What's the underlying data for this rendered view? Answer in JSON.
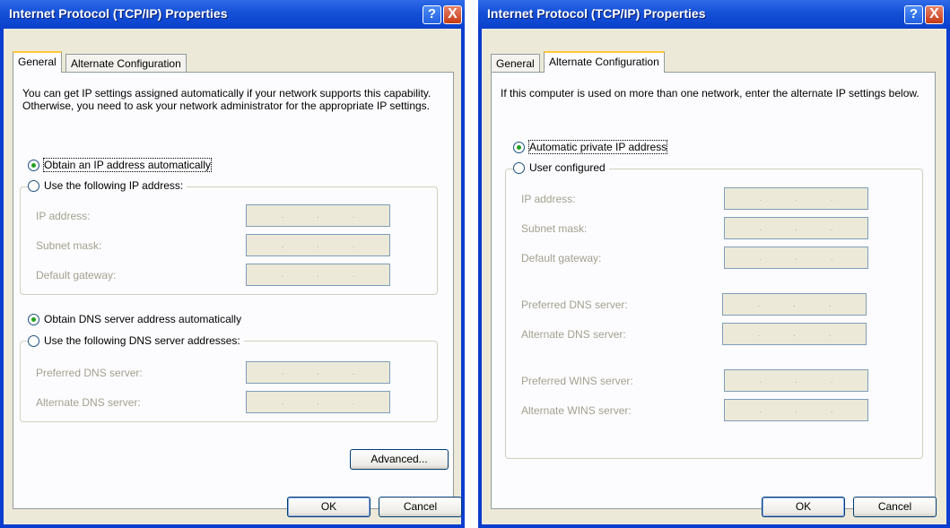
{
  "left": {
    "title": "Internet Protocol (TCP/IP) Properties",
    "help_label": "?",
    "close_label": "X",
    "tabs": [
      {
        "label": "General",
        "active": true
      },
      {
        "label": "Alternate Configuration",
        "active": false
      }
    ],
    "intro": "You can get IP settings assigned automatically if your network supports this capability. Otherwise, you need to ask your network administrator for the appropriate IP settings.",
    "ip_auto_label": "Obtain an IP address automatically",
    "ip_manual_label": "Use the following IP address:",
    "fields_ip": [
      {
        "label": "IP address:",
        "value": ". . ."
      },
      {
        "label": "Subnet mask:",
        "value": ". . ."
      },
      {
        "label": "Default gateway:",
        "value": ". . ."
      }
    ],
    "dns_auto_label": "Obtain DNS server address automatically",
    "dns_manual_label": "Use the following DNS server addresses:",
    "fields_dns": [
      {
        "label": "Preferred DNS server:",
        "value": ". . ."
      },
      {
        "label": "Alternate DNS server:",
        "value": ". . ."
      }
    ],
    "advanced_label": "Advanced...",
    "ok_label": "OK",
    "cancel_label": "Cancel"
  },
  "right": {
    "title": "Internet Protocol (TCP/IP) Properties",
    "help_label": "?",
    "close_label": "X",
    "tabs": [
      {
        "label": "General",
        "active": false
      },
      {
        "label": "Alternate Configuration",
        "active": true
      }
    ],
    "intro": "If this computer is used on more than one network, enter the alternate IP settings below.",
    "auto_private_label": "Automatic private IP address",
    "user_configured_label": "User configured",
    "fields": [
      {
        "label": "IP address:",
        "value": ". . ."
      },
      {
        "label": "Subnet mask:",
        "value": ". . ."
      },
      {
        "label": "Default gateway:",
        "value": ". . ."
      },
      {
        "label": "Preferred DNS server:",
        "value": ". . ."
      },
      {
        "label": "Alternate DNS server:",
        "value": ". . ."
      },
      {
        "label": "Preferred WINS server:",
        "value": ". . ."
      },
      {
        "label": "Alternate WINS server:",
        "value": ". . ."
      }
    ],
    "ok_label": "OK",
    "cancel_label": "Cancel"
  },
  "colors": {
    "titlebar": "#0a40cc",
    "dialog_bg": "#ece9d8",
    "panel_bg": "#fcfcfe",
    "radio_dot": "#21a121",
    "disabled_text": "#a3a08f"
  },
  "icons": [
    "help-icon",
    "close-icon"
  ]
}
